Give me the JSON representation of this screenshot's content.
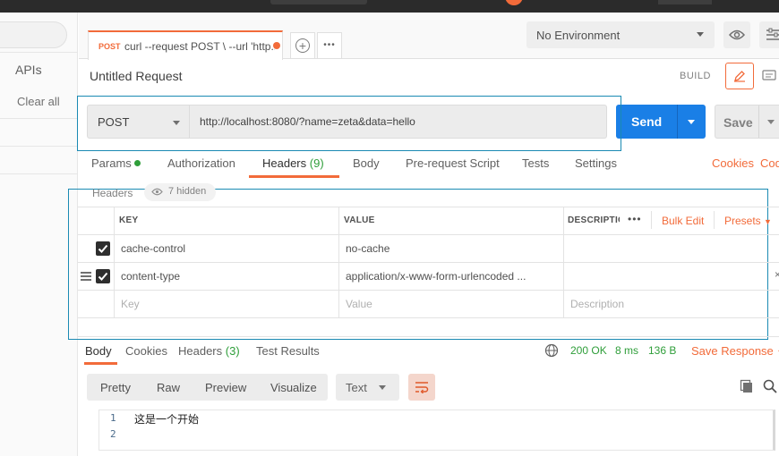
{
  "sidebar": {
    "apis": "APIs",
    "clear_all": "Clear all"
  },
  "tabs": [
    {
      "method": "POST",
      "title": "curl --request POST \\ --url 'http..."
    }
  ],
  "environment": {
    "selected": "No Environment"
  },
  "request": {
    "title": "Untitled Request",
    "build": "BUILD",
    "method": "POST",
    "url": "http://localhost:8080/?name=zeta&data=hello",
    "send": "Send",
    "save": "Save"
  },
  "request_tabs": {
    "params": "Params",
    "authorization": "Authorization",
    "headers": "Headers",
    "headers_count": "(9)",
    "body": "Body",
    "prerequest": "Pre-request Script",
    "tests": "Tests",
    "settings": "Settings",
    "cookies": "Cookies",
    "code": "Code"
  },
  "headers_section": {
    "title": "Headers",
    "hidden": "7 hidden",
    "columns": {
      "key": "KEY",
      "value": "VALUE",
      "description": "DESCRIPTIO",
      "bulk_edit": "Bulk Edit",
      "presets": "Presets"
    },
    "rows": [
      {
        "key": "cache-control",
        "value": "no-cache",
        "checked": true
      },
      {
        "key": "content-type",
        "value": "application/x-www-form-urlencoded ...",
        "checked": true
      }
    ],
    "placeholder": {
      "key": "Key",
      "value": "Value",
      "description": "Description"
    }
  },
  "response": {
    "tabs": {
      "body": "Body",
      "cookies": "Cookies",
      "headers": "Headers",
      "headers_count": "(3)",
      "tests": "Test Results"
    },
    "status": "200 OK",
    "time": "8 ms",
    "size": "136 B",
    "save_response": "Save Response",
    "view": {
      "pretty": "Pretty",
      "raw": "Raw",
      "preview": "Preview",
      "visualize": "Visualize",
      "format": "Text"
    },
    "lines": [
      {
        "n": "1",
        "text": "这是一个开始"
      },
      {
        "n": "2",
        "text": ""
      }
    ]
  },
  "colors": {
    "accent": "#f26b3a",
    "send": "#1a7fe6",
    "ok": "#2f9e3a"
  }
}
